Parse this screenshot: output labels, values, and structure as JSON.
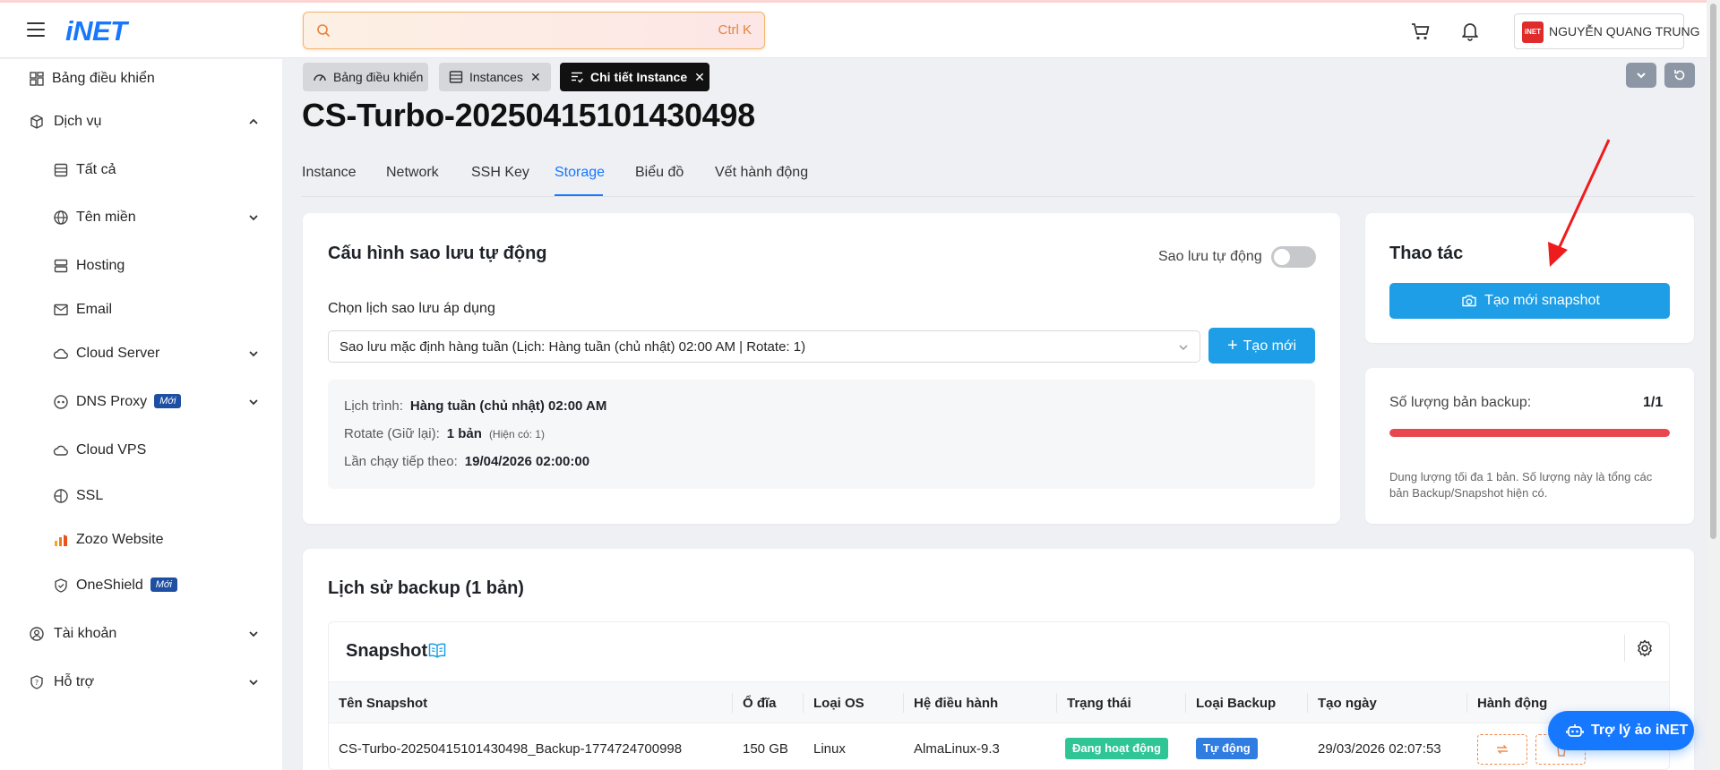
{
  "header": {
    "logo": "iNET",
    "search": {
      "placeholder": "",
      "shortcut": "Ctrl K"
    },
    "user": {
      "avatar_text": "iNET",
      "name": "NGUYỄN QUANG TRUNG"
    }
  },
  "sidebar": {
    "items": [
      {
        "label": "Bảng điều khiển",
        "icon": "dashboard-icon"
      },
      {
        "label": "Dịch vụ",
        "icon": "box-icon",
        "expanded": true
      },
      {
        "label": "Tất cả",
        "icon": "list-icon"
      },
      {
        "label": "Tên miền",
        "icon": "globe-icon"
      },
      {
        "label": "Hosting",
        "icon": "server-icon"
      },
      {
        "label": "Email",
        "icon": "mail-icon"
      },
      {
        "label": "Cloud Server",
        "icon": "cloud-icon"
      },
      {
        "label": "DNS Proxy",
        "icon": "dns-icon",
        "badge": "Mới"
      },
      {
        "label": "Cloud VPS",
        "icon": "cloud-icon"
      },
      {
        "label": "SSL",
        "icon": "ssl-icon"
      },
      {
        "label": "Zozo Website",
        "icon": "zozo-icon"
      },
      {
        "label": "OneShield",
        "icon": "shield-icon",
        "badge": "Mới"
      },
      {
        "label": "Tài khoản",
        "icon": "user-icon"
      },
      {
        "label": "Hỗ trợ",
        "icon": "help-icon"
      }
    ]
  },
  "page_tabs": [
    {
      "label": "Bảng điều khiển",
      "closable": false
    },
    {
      "label": "Instances",
      "closable": true
    },
    {
      "label": "Chi tiết Instance",
      "closable": true,
      "active": true
    }
  ],
  "page_title": "CS-Turbo-20250415101430498",
  "nav_tabs": [
    "Instance",
    "Network",
    "SSH Key",
    "Storage",
    "Biểu đồ",
    "Vết hành động"
  ],
  "nav_active": "Storage",
  "auto_backup": {
    "title": "Cấu hình sao lưu tự động",
    "toggle_label": "Sao lưu tự động",
    "toggle_on": false,
    "select_label": "Chọn lịch sao lưu áp dụng",
    "select_value": "Sao lưu mặc định hàng tuần (Lịch: Hàng tuần (chủ nhật) 02:00 AM | Rotate: 1)",
    "create_label": "Tạo mới",
    "schedule": {
      "schedule_label": "Lịch trình:",
      "schedule_value": "Hàng tuần (chủ nhật) 02:00 AM",
      "rotate_label": "Rotate (Giữ lại):",
      "rotate_value": "1 bản",
      "rotate_current": "(Hiện có: 1)",
      "next_run_label": "Lần chạy tiếp theo:",
      "next_run_value": "19/04/2026 02:00:00"
    }
  },
  "actions": {
    "title": "Thao tác",
    "snapshot_button": "Tạo mới snapshot"
  },
  "backup_count": {
    "label": "Số lượng bản backup:",
    "value": "1/1",
    "fill_fraction": 1.0,
    "note": "Dung lượng tối đa 1 bản. Số lượng này là tổng các bản Backup/Snapshot hiện có."
  },
  "history": {
    "title": "Lịch sử backup (1 bản)",
    "table_title": "Snapshot",
    "columns": [
      "Tên Snapshot",
      "Ổ đĩa",
      "Loại OS",
      "Hệ điều hành",
      "Trạng thái",
      "Loại Backup",
      "Tạo ngày",
      "Hành động"
    ],
    "rows": [
      {
        "name": "CS-Turbo-20250415101430498_Backup-1774724700998",
        "disk": "150 GB",
        "os_type": "Linux",
        "os": "AlmaLinux-9.3",
        "status": "Đang hoạt động",
        "backup_type": "Tự động",
        "created": "29/03/2026 02:07:53"
      }
    ]
  },
  "assistant": {
    "label": "Trợ lý ảo iNET"
  },
  "colors": {
    "primary": "#1677ff",
    "button_blue": "#1d9ee6",
    "status_green": "#2fc594",
    "backup_type_blue": "#2f7de1",
    "progress_red": "#e8474f",
    "annotation_arrow": "#ee1c1c"
  }
}
